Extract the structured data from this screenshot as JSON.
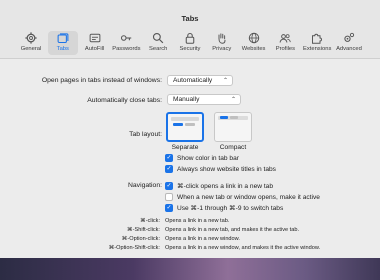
{
  "window": {
    "title": "Tabs"
  },
  "toolbar": {
    "items": [
      {
        "label": "General",
        "icon": "gear-icon"
      },
      {
        "label": "Tabs",
        "icon": "tabs-icon",
        "selected": true
      },
      {
        "label": "AutoFill",
        "icon": "autofill-icon"
      },
      {
        "label": "Passwords",
        "icon": "key-icon"
      },
      {
        "label": "Search",
        "icon": "search-icon"
      },
      {
        "label": "Security",
        "icon": "lock-icon"
      },
      {
        "label": "Privacy",
        "icon": "hand-icon"
      },
      {
        "label": "Websites",
        "icon": "globe-icon"
      },
      {
        "label": "Profiles",
        "icon": "profiles-icon"
      },
      {
        "label": "Extensions",
        "icon": "puzzle-icon"
      },
      {
        "label": "Advanced",
        "icon": "advanced-gear-icon"
      }
    ]
  },
  "settings": {
    "open_pages_label": "Open pages in tabs instead of windows:",
    "open_pages_value": "Automatically",
    "auto_close_label": "Automatically close tabs:",
    "auto_close_value": "Manually",
    "tab_layout_label": "Tab layout:",
    "layout_options": [
      {
        "label": "Separate",
        "selected": true
      },
      {
        "label": "Compact",
        "selected": false
      }
    ],
    "checkbox_color": "Show color in tab bar",
    "checkbox_titles": "Always show website titles in tabs",
    "navigation_label": "Navigation:",
    "nav_click": "⌘-click opens a link in a new tab",
    "nav_new_tab": "When a new tab or window opens, make it active",
    "nav_switch": "Use ⌘-1 through ⌘-9 to switch tabs"
  },
  "shortcuts": [
    {
      "key": "⌘-click:",
      "desc": "Opens a link in a new tab."
    },
    {
      "key": "⌘-Shift-click:",
      "desc": "Opens a link in a new tab, and makes it the active tab."
    },
    {
      "key": "⌘-Option-click:",
      "desc": "Opens a link in a new window."
    },
    {
      "key": "⌘-Option-Shift-click:",
      "desc": "Opens a link in a new window, and makes it the active window."
    }
  ],
  "colors": {
    "accent": "#1a73e8",
    "window_bg": "#ececec"
  }
}
